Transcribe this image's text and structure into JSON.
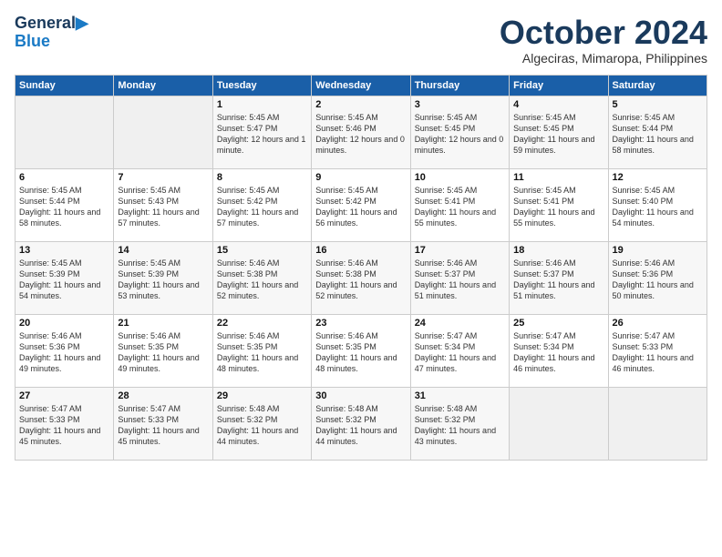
{
  "logo": {
    "line1": "General",
    "line2": "Blue"
  },
  "title": "October 2024",
  "subtitle": "Algeciras, Mimaropa, Philippines",
  "weekdays": [
    "Sunday",
    "Monday",
    "Tuesday",
    "Wednesday",
    "Thursday",
    "Friday",
    "Saturday"
  ],
  "weeks": [
    [
      {
        "day": "",
        "sunrise": "",
        "sunset": "",
        "daylight": ""
      },
      {
        "day": "",
        "sunrise": "",
        "sunset": "",
        "daylight": ""
      },
      {
        "day": "1",
        "sunrise": "Sunrise: 5:45 AM",
        "sunset": "Sunset: 5:47 PM",
        "daylight": "Daylight: 12 hours and 1 minute."
      },
      {
        "day": "2",
        "sunrise": "Sunrise: 5:45 AM",
        "sunset": "Sunset: 5:46 PM",
        "daylight": "Daylight: 12 hours and 0 minutes."
      },
      {
        "day": "3",
        "sunrise": "Sunrise: 5:45 AM",
        "sunset": "Sunset: 5:45 PM",
        "daylight": "Daylight: 12 hours and 0 minutes."
      },
      {
        "day": "4",
        "sunrise": "Sunrise: 5:45 AM",
        "sunset": "Sunset: 5:45 PM",
        "daylight": "Daylight: 11 hours and 59 minutes."
      },
      {
        "day": "5",
        "sunrise": "Sunrise: 5:45 AM",
        "sunset": "Sunset: 5:44 PM",
        "daylight": "Daylight: 11 hours and 58 minutes."
      }
    ],
    [
      {
        "day": "6",
        "sunrise": "Sunrise: 5:45 AM",
        "sunset": "Sunset: 5:44 PM",
        "daylight": "Daylight: 11 hours and 58 minutes."
      },
      {
        "day": "7",
        "sunrise": "Sunrise: 5:45 AM",
        "sunset": "Sunset: 5:43 PM",
        "daylight": "Daylight: 11 hours and 57 minutes."
      },
      {
        "day": "8",
        "sunrise": "Sunrise: 5:45 AM",
        "sunset": "Sunset: 5:42 PM",
        "daylight": "Daylight: 11 hours and 57 minutes."
      },
      {
        "day": "9",
        "sunrise": "Sunrise: 5:45 AM",
        "sunset": "Sunset: 5:42 PM",
        "daylight": "Daylight: 11 hours and 56 minutes."
      },
      {
        "day": "10",
        "sunrise": "Sunrise: 5:45 AM",
        "sunset": "Sunset: 5:41 PM",
        "daylight": "Daylight: 11 hours and 55 minutes."
      },
      {
        "day": "11",
        "sunrise": "Sunrise: 5:45 AM",
        "sunset": "Sunset: 5:41 PM",
        "daylight": "Daylight: 11 hours and 55 minutes."
      },
      {
        "day": "12",
        "sunrise": "Sunrise: 5:45 AM",
        "sunset": "Sunset: 5:40 PM",
        "daylight": "Daylight: 11 hours and 54 minutes."
      }
    ],
    [
      {
        "day": "13",
        "sunrise": "Sunrise: 5:45 AM",
        "sunset": "Sunset: 5:39 PM",
        "daylight": "Daylight: 11 hours and 54 minutes."
      },
      {
        "day": "14",
        "sunrise": "Sunrise: 5:45 AM",
        "sunset": "Sunset: 5:39 PM",
        "daylight": "Daylight: 11 hours and 53 minutes."
      },
      {
        "day": "15",
        "sunrise": "Sunrise: 5:46 AM",
        "sunset": "Sunset: 5:38 PM",
        "daylight": "Daylight: 11 hours and 52 minutes."
      },
      {
        "day": "16",
        "sunrise": "Sunrise: 5:46 AM",
        "sunset": "Sunset: 5:38 PM",
        "daylight": "Daylight: 11 hours and 52 minutes."
      },
      {
        "day": "17",
        "sunrise": "Sunrise: 5:46 AM",
        "sunset": "Sunset: 5:37 PM",
        "daylight": "Daylight: 11 hours and 51 minutes."
      },
      {
        "day": "18",
        "sunrise": "Sunrise: 5:46 AM",
        "sunset": "Sunset: 5:37 PM",
        "daylight": "Daylight: 11 hours and 51 minutes."
      },
      {
        "day": "19",
        "sunrise": "Sunrise: 5:46 AM",
        "sunset": "Sunset: 5:36 PM",
        "daylight": "Daylight: 11 hours and 50 minutes."
      }
    ],
    [
      {
        "day": "20",
        "sunrise": "Sunrise: 5:46 AM",
        "sunset": "Sunset: 5:36 PM",
        "daylight": "Daylight: 11 hours and 49 minutes."
      },
      {
        "day": "21",
        "sunrise": "Sunrise: 5:46 AM",
        "sunset": "Sunset: 5:35 PM",
        "daylight": "Daylight: 11 hours and 49 minutes."
      },
      {
        "day": "22",
        "sunrise": "Sunrise: 5:46 AM",
        "sunset": "Sunset: 5:35 PM",
        "daylight": "Daylight: 11 hours and 48 minutes."
      },
      {
        "day": "23",
        "sunrise": "Sunrise: 5:46 AM",
        "sunset": "Sunset: 5:35 PM",
        "daylight": "Daylight: 11 hours and 48 minutes."
      },
      {
        "day": "24",
        "sunrise": "Sunrise: 5:47 AM",
        "sunset": "Sunset: 5:34 PM",
        "daylight": "Daylight: 11 hours and 47 minutes."
      },
      {
        "day": "25",
        "sunrise": "Sunrise: 5:47 AM",
        "sunset": "Sunset: 5:34 PM",
        "daylight": "Daylight: 11 hours and 46 minutes."
      },
      {
        "day": "26",
        "sunrise": "Sunrise: 5:47 AM",
        "sunset": "Sunset: 5:33 PM",
        "daylight": "Daylight: 11 hours and 46 minutes."
      }
    ],
    [
      {
        "day": "27",
        "sunrise": "Sunrise: 5:47 AM",
        "sunset": "Sunset: 5:33 PM",
        "daylight": "Daylight: 11 hours and 45 minutes."
      },
      {
        "day": "28",
        "sunrise": "Sunrise: 5:47 AM",
        "sunset": "Sunset: 5:33 PM",
        "daylight": "Daylight: 11 hours and 45 minutes."
      },
      {
        "day": "29",
        "sunrise": "Sunrise: 5:48 AM",
        "sunset": "Sunset: 5:32 PM",
        "daylight": "Daylight: 11 hours and 44 minutes."
      },
      {
        "day": "30",
        "sunrise": "Sunrise: 5:48 AM",
        "sunset": "Sunset: 5:32 PM",
        "daylight": "Daylight: 11 hours and 44 minutes."
      },
      {
        "day": "31",
        "sunrise": "Sunrise: 5:48 AM",
        "sunset": "Sunset: 5:32 PM",
        "daylight": "Daylight: 11 hours and 43 minutes."
      },
      {
        "day": "",
        "sunrise": "",
        "sunset": "",
        "daylight": ""
      },
      {
        "day": "",
        "sunrise": "",
        "sunset": "",
        "daylight": ""
      }
    ]
  ]
}
